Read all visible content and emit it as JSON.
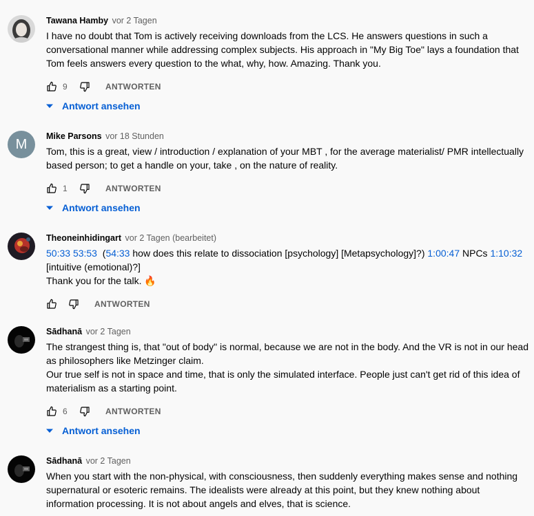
{
  "comments": [
    {
      "author": "Tawana Hamby",
      "time": "vor 2 Tagen",
      "lines": [
        "I have no doubt that Tom is actively receiving downloads from the LCS. He answers questions in such a conversational manner while addressing complex subjects. His approach in \"My Big Toe\" lays a foundation that Tom feels answers every question to the what, why, how. Amazing. Thank you."
      ],
      "likes": "9",
      "reply_label": "ANTWORTEN",
      "view_replies": "Antwort ansehen"
    },
    {
      "author": "Mike Parsons",
      "time": "vor 18 Stunden",
      "avatar_letter": "M",
      "lines": [
        "Tom, this is a great, view / introduction / explanation of your MBT , for the average materialist/ PMR intellectually based person; to get a handle on your, take , on the nature of reality."
      ],
      "likes": "1",
      "reply_label": "ANTWORTEN",
      "view_replies": "Antwort ansehen"
    },
    {
      "author": "Theoneinhidingart",
      "time": "vor 2 Tagen (bearbeitet)",
      "timestamps": [
        "50:33",
        "53:53",
        "54:33",
        "1:00:47",
        "1:10:32"
      ],
      "segments": [
        " ",
        "  (",
        " how does this relate to dissociation [psychology] [Metapsychology]?) ",
        " NPCs ",
        " [intuitive (emotional)?]"
      ],
      "line2": "Thank you for the talk. 🔥",
      "likes": "",
      "reply_label": "ANTWORTEN"
    },
    {
      "author": "Sādhanā",
      "time": "vor 2 Tagen",
      "lines": [
        "The strangest thing is, that \"out of body\" is normal,  because we are not in the body. And the VR is not in our head as philosophers like Metzinger claim.",
        "Our true self is not in space and time, that is only the simulated interface. People just can't get rid of this idea of materialism as a starting point."
      ],
      "likes": "6",
      "reply_label": "ANTWORTEN",
      "view_replies": "Antwort ansehen"
    },
    {
      "author": "Sādhanā",
      "time": "vor 2 Tagen",
      "lines": [
        "When you start with the non-physical, with consciousness, then suddenly everything makes sense and nothing supernatural or esoteric remains. The idealists were already at this point, but they knew nothing about information processing. It is not about angels and elves, that is science."
      ]
    }
  ],
  "colors": {
    "link": "#065fd4",
    "meta": "#606060",
    "avatar_m": "#78909c"
  },
  "icons": {
    "like": "thumb-up-icon",
    "dislike": "thumb-down-icon",
    "caret": "caret-down-icon",
    "fire": "fire-emoji"
  }
}
